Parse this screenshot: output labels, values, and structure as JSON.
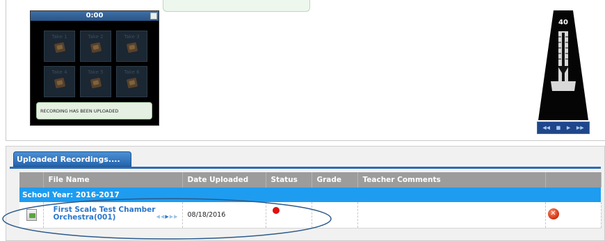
{
  "recorder": {
    "time": "0:00",
    "takes": [
      "Take 1",
      "Take 2",
      "Take 3",
      "Take 4",
      "Take 5",
      "Take 6"
    ],
    "status_message": "RECORDING HAS BEEN UPLOADED"
  },
  "metronome": {
    "tempo": "40",
    "controls": [
      "rewind-icon",
      "stop-icon",
      "play-icon",
      "fast-forward-icon"
    ]
  },
  "uploads": {
    "tab_label": "Uploaded Recordings....",
    "columns": [
      "",
      "File Name",
      "Date Uploaded",
      "Status",
      "Grade",
      "Teacher Comments",
      ""
    ],
    "school_year": "School Year: 2016-2017",
    "rows": [
      {
        "file_name": "First Scale Test Chamber Orchestra(001)",
        "date_uploaded": "08/18/2016",
        "status_color": "#e01010",
        "grade": "",
        "teacher_comments": ""
      }
    ]
  },
  "colors": {
    "accent_blue": "#1e9cf0",
    "link_blue": "#2b76c9",
    "header_gray": "#9c9c9c",
    "status_red": "#e01010"
  }
}
